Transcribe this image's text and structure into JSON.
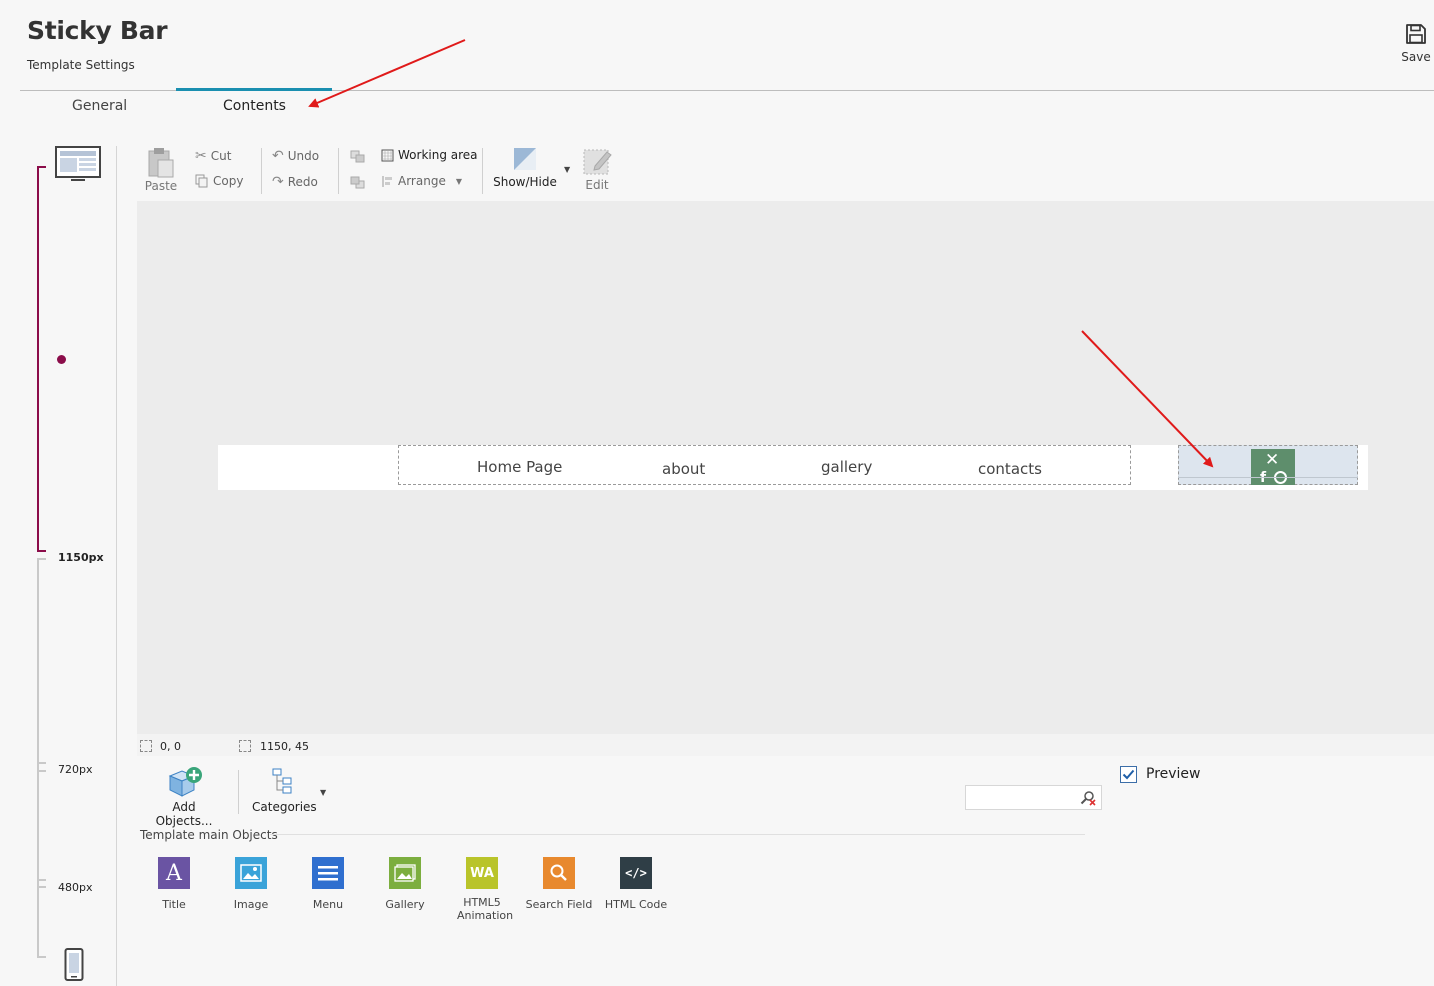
{
  "header": {
    "title": "Sticky Bar",
    "subtitle": "Template Settings",
    "save_label": "Save"
  },
  "tabs": [
    {
      "label": "General",
      "active": false
    },
    {
      "label": "Contents",
      "active": true
    }
  ],
  "breakpoints": [
    "1150px",
    "720px",
    "480px"
  ],
  "toolbar": {
    "paste": "Paste",
    "cut": "Cut",
    "copy": "Copy",
    "undo": "Undo",
    "redo": "Redo",
    "working_area": "Working area",
    "arrange": "Arrange",
    "show_hide": "Show/Hide",
    "edit": "Edit"
  },
  "canvas": {
    "menu_items": [
      "Home Page",
      "about",
      "gallery",
      "contacts"
    ]
  },
  "status": {
    "position": "0, 0",
    "size": "1150, 45"
  },
  "objects_panel": {
    "add_objects": "Add Objects...",
    "categories": "Categories",
    "section_title": "Template main Objects",
    "preview_label": "Preview",
    "preview_checked": true,
    "search_value": "",
    "items": [
      {
        "label": "Title",
        "icon": "title-icon",
        "color": "#6a54a3"
      },
      {
        "label": "Image",
        "icon": "image-icon",
        "color": "#3aa3d9"
      },
      {
        "label": "Menu",
        "icon": "menu-icon",
        "color": "#2f6fcf"
      },
      {
        "label": "Gallery",
        "icon": "gallery-icon",
        "color": "#7cae3f"
      },
      {
        "label": "HTML5 Animation",
        "icon": "html5-animation-icon",
        "color": "#b9c42a"
      },
      {
        "label": "Search Field",
        "icon": "search-field-icon",
        "color": "#e8892e"
      },
      {
        "label": "HTML Code",
        "icon": "html-code-icon",
        "color": "#2f3e46"
      }
    ]
  },
  "colors": {
    "accent": "#1a8fb0",
    "breakpoint_active": "#8b0d4a",
    "annotation_arrow": "#e01a1a"
  }
}
